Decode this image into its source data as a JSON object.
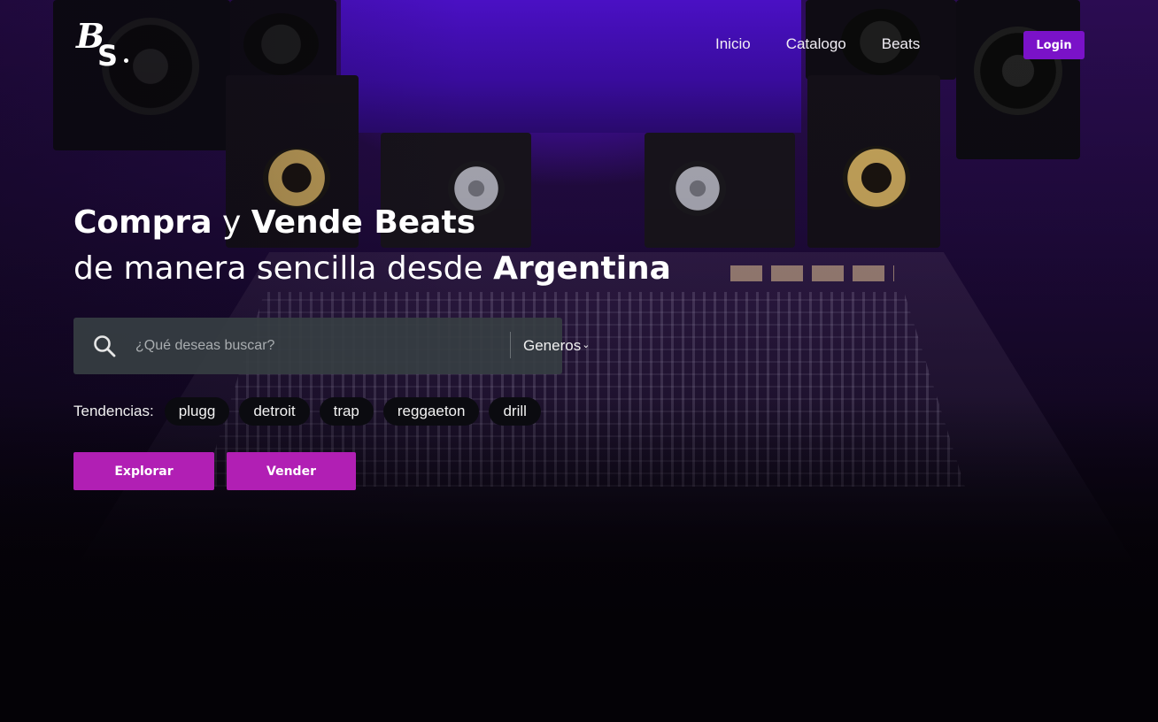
{
  "header": {
    "nav": [
      "Inicio",
      "Catalogo",
      "Beats"
    ],
    "login_label": "Login"
  },
  "hero": {
    "line1": {
      "w1": "Compra",
      "w2": "y",
      "w3": "Vende Beats"
    },
    "line2": {
      "w1": "de manera sencilla desde",
      "w2": "Argentina"
    }
  },
  "search": {
    "placeholder": "¿Qué deseas buscar?",
    "genres_label": "Generos",
    "search_icon": "search-icon",
    "dropdown_icon": "chevron-down-icon"
  },
  "trends": {
    "label": "Tendencias:",
    "tags": [
      "plugg",
      "detroit",
      "trap",
      "reggaeton",
      "drill"
    ]
  },
  "actions": {
    "explore_label": "Explorar",
    "sell_label": "Vender"
  },
  "colors": {
    "login_bg": "#7a12c8",
    "cta_bg": "#b11fb4",
    "search_bg": "#363e42",
    "tag_bg": "#0b0b10"
  }
}
